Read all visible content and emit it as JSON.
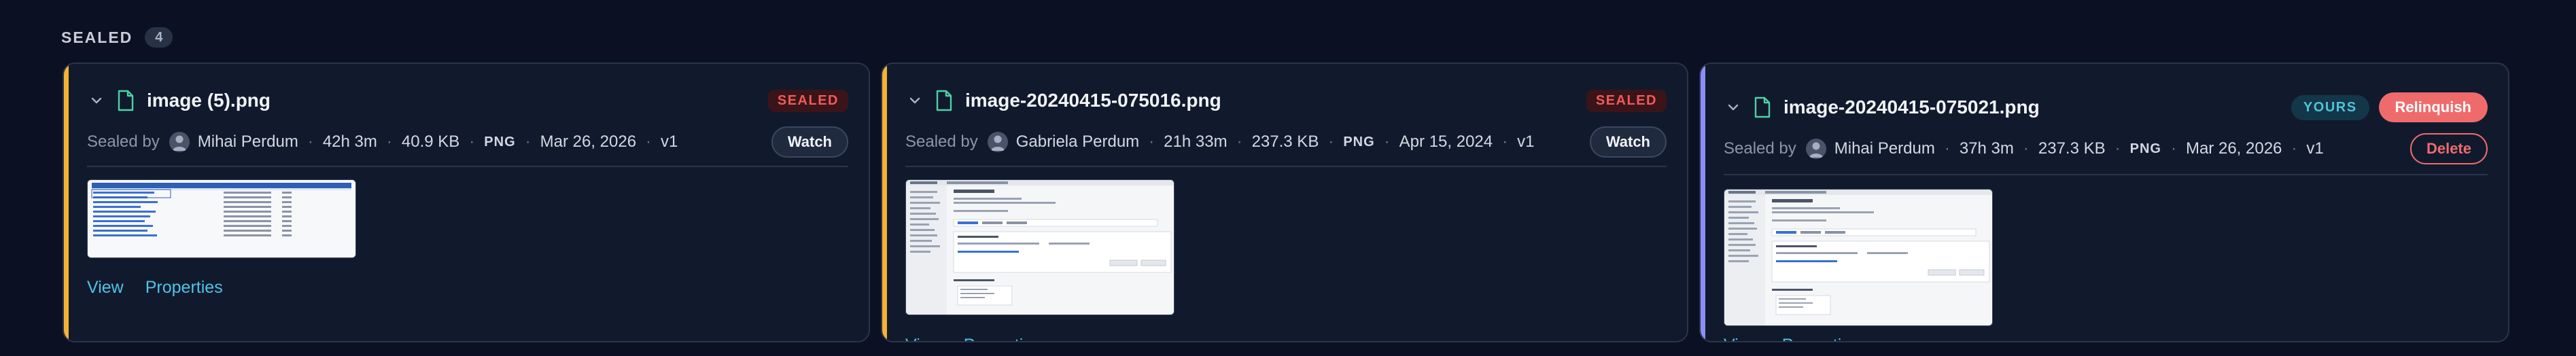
{
  "section": {
    "title": "SEALED",
    "count": "4"
  },
  "cards": [
    {
      "file_name": "image (5).png",
      "status_badge": "SEALED",
      "sealed_by_label": "Sealed by",
      "user": "Mihai Perdum",
      "age": "42h 3m",
      "size": "40.9 KB",
      "format": "PNG",
      "date": "Mar 26, 2026",
      "version": "v1",
      "action_label": "Watch",
      "links": {
        "view": "View",
        "properties": "Properties"
      },
      "accent_color": "#f5b335"
    },
    {
      "file_name": "image-20240415-075016.png",
      "status_badge": "SEALED",
      "sealed_by_label": "Sealed by",
      "user": "Gabriela Perdum",
      "age": "21h 33m",
      "size": "237.3 KB",
      "format": "PNG",
      "date": "Apr 15, 2024",
      "version": "v1",
      "action_label": "Watch",
      "links": {
        "view": "View",
        "properties": "Properties"
      },
      "accent_color": "#f5b335"
    },
    {
      "file_name": "image-20240415-075021.png",
      "status_badge": "YOURS",
      "primary_action": "Relinquish",
      "sealed_by_label": "Sealed by",
      "user": "Mihai Perdum",
      "age": "37h 3m",
      "size": "237.3 KB",
      "format": "PNG",
      "date": "Mar 26, 2026",
      "version": "v1",
      "action_label": "Delete",
      "links": {
        "view": "View",
        "properties": "Properties"
      },
      "accent_color": "#8b8ff5"
    }
  ],
  "colors": {
    "background": "#0b1122",
    "card": "#111a2d",
    "sealed_red": "#ef5b5b",
    "yours_cyan": "#4fc3d9",
    "link": "#4fc3e6"
  }
}
